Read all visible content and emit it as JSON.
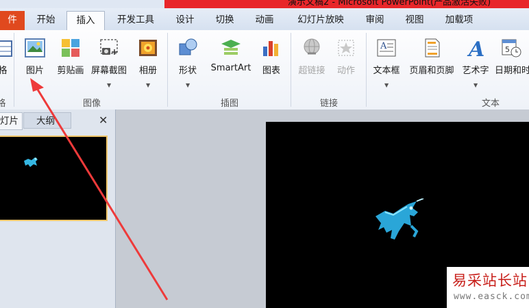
{
  "window": {
    "title_partial": "演示文稿2 - Microsoft PowerPoint(产品激活失败)"
  },
  "tabs": [
    "件",
    "开始",
    "插入",
    "开发工具",
    "设计",
    "切换",
    "动画",
    "幻灯片放映",
    "审阅",
    "视图",
    "加载项"
  ],
  "active_tab": "插入",
  "ribbon": {
    "cut_left": {
      "label": "格",
      "group": "格"
    },
    "images": {
      "group": "图像",
      "buttons": [
        "图片",
        "剪贴画",
        "屏幕截图",
        "相册"
      ]
    },
    "illustrations": {
      "group": "插图",
      "buttons": [
        "形状",
        "SmartArt",
        "图表"
      ]
    },
    "links": {
      "group": "链接",
      "buttons": [
        "超链接",
        "动作"
      ]
    },
    "text": {
      "group": "文本",
      "buttons": [
        "文本框",
        "页眉和页脚",
        "艺术字",
        "日期和时"
      ]
    }
  },
  "pane": {
    "tabs": [
      "灯片",
      "大纲"
    ],
    "close": "✕"
  },
  "watermark": {
    "cn": "易采站长站",
    "en": "www.easck.com"
  },
  "colors": {
    "file_tab": "#e0491e",
    "title_red": "#e8262a",
    "arrow": "#ee3a3a",
    "thumb_border": "#f0c66a"
  }
}
